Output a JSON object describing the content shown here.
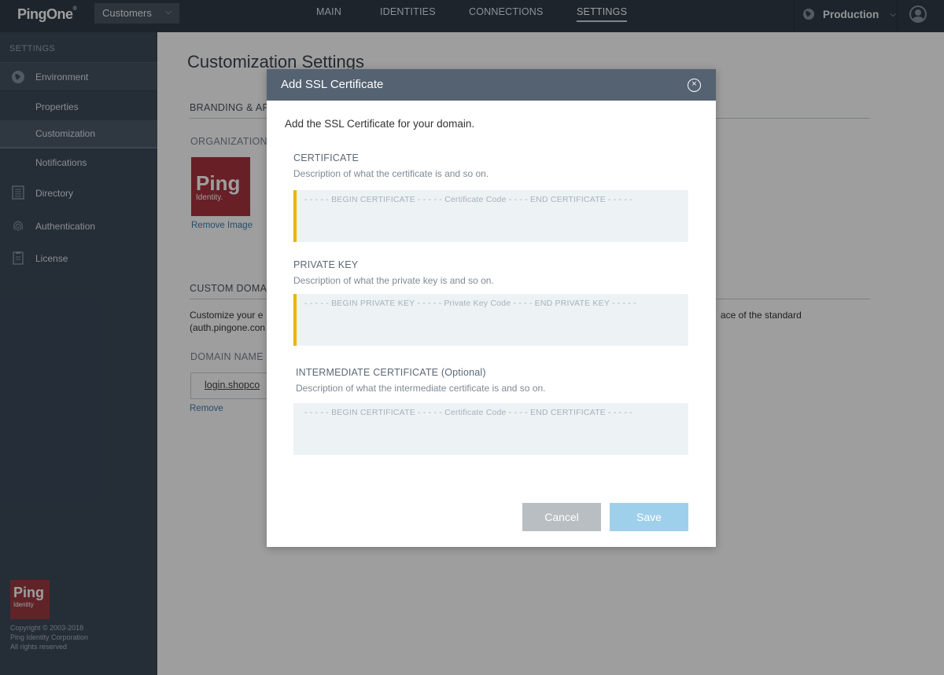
{
  "topnav": {
    "logo": "PingOne",
    "env_select": "Customers",
    "links": [
      "MAIN",
      "IDENTITIES",
      "CONNECTIONS",
      "SETTINGS"
    ],
    "active_link": "SETTINGS",
    "environment": "Production"
  },
  "sidebar": {
    "section_title": "SETTINGS",
    "items": {
      "environment": "Environment",
      "properties": "Properties",
      "customization": "Customization",
      "notifications": "Notifications",
      "directory": "Directory",
      "authentication": "Authentication",
      "license": "License"
    },
    "footer_logo": "Ping",
    "footer_logo_sub": "Identity",
    "copyright": [
      "Copyright © 2003-2018",
      "Ping Identity Corporation",
      "All rights reserved"
    ]
  },
  "main": {
    "title": "Customization Settings",
    "branding_head": "BRANDING & AP",
    "org_label": "ORGANIZATION",
    "org_logo_text": "Ping",
    "org_logo_sub": "Identity.",
    "remove_image": "Remove Image",
    "custom_domain_head": "CUSTOM DOMAI",
    "desc_line1_start": "Customize your e",
    "desc_line1_end": "ace of the standard",
    "desc_line2": "(auth.pingone.con",
    "domain_label": "DOMAIN NAME",
    "domain_value": "login.shopco",
    "remove": "Remove"
  },
  "modal": {
    "title": "Add SSL Certificate",
    "intro": "Add the SSL Certificate for your domain.",
    "certificate": {
      "title": "CERTIFICATE",
      "desc": "Description of what the certificate is and so on.",
      "placeholder": "- - - - - BEGIN CERTIFICATE - - - - - Certificate Code - - - - END CERTIFICATE - - - - -"
    },
    "private_key": {
      "title": "PRIVATE KEY",
      "desc": "Description of what the private key is and so on.",
      "placeholder": "- - - - - BEGIN PRIVATE KEY - - - - - Private Key Code - - - - END PRIVATE KEY - - - - -"
    },
    "intermediate": {
      "title": "INTERMEDIATE CERTIFICATE (Optional)",
      "desc": "Description of what the intermediate certificate is and so on.",
      "placeholder": "- - - - - BEGIN CERTIFICATE - - - - - Certificate Code - - - - END CERTIFICATE - - - - -"
    },
    "cancel": "Cancel",
    "save": "Save"
  },
  "colors": {
    "nav_bg": "#2f3b48",
    "sidebar_bg": "#3c4b5a",
    "required_accent": "#e9b400",
    "save_button": "#9fd0eb",
    "modal_header": "#556271"
  }
}
